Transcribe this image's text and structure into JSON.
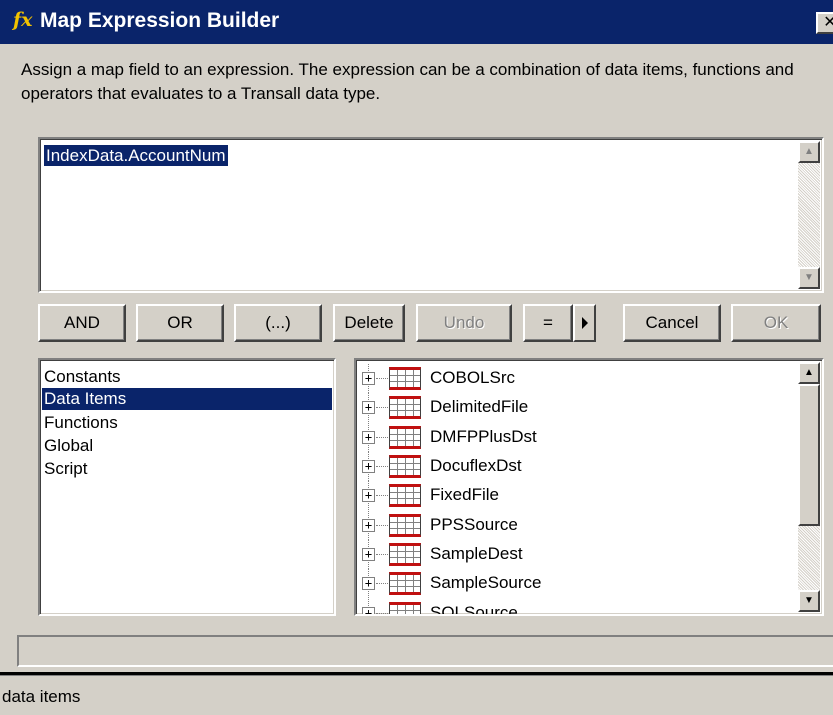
{
  "window": {
    "title": "Map Expression Builder",
    "icon_text": "fx",
    "icon": "fx-function-icon",
    "close_icon": "close-icon",
    "close_glyph": "✕"
  },
  "description": "Assign a map field to an expression. The expression can be a combination of data items, functions and operators that evaluates to a Transall data type.",
  "expression": {
    "value": "IndexData.AccountNum"
  },
  "buttons": {
    "and": "AND",
    "or": "OR",
    "paren": "(...)",
    "delete": "Delete",
    "undo": "Undo",
    "equals": "=",
    "cancel": "Cancel",
    "ok": "OK"
  },
  "categories": [
    {
      "label": "Constants",
      "selected": false
    },
    {
      "label": "Data Items",
      "selected": true
    },
    {
      "label": "Functions",
      "selected": false
    },
    {
      "label": "Global",
      "selected": false
    },
    {
      "label": "Script",
      "selected": false
    }
  ],
  "tree": [
    {
      "label": "COBOLSrc",
      "expander": "+"
    },
    {
      "label": "DelimitedFile",
      "expander": "+"
    },
    {
      "label": "DMFPPlusDst",
      "expander": "+"
    },
    {
      "label": "DocuflexDst",
      "expander": "+"
    },
    {
      "label": "FixedFile",
      "expander": "+"
    },
    {
      "label": "PPSSource",
      "expander": "+"
    },
    {
      "label": "SampleDest",
      "expander": "+"
    },
    {
      "label": "SampleSource",
      "expander": "+"
    },
    {
      "label": "SQLSource",
      "expander": "+"
    }
  ],
  "scroll_arrows": {
    "up": "▲",
    "down": "▼"
  },
  "status": {
    "text": "data items"
  },
  "colors": {
    "title_bar": "#0a246a",
    "selection": "#0a246a",
    "face": "#d4d0c8"
  }
}
